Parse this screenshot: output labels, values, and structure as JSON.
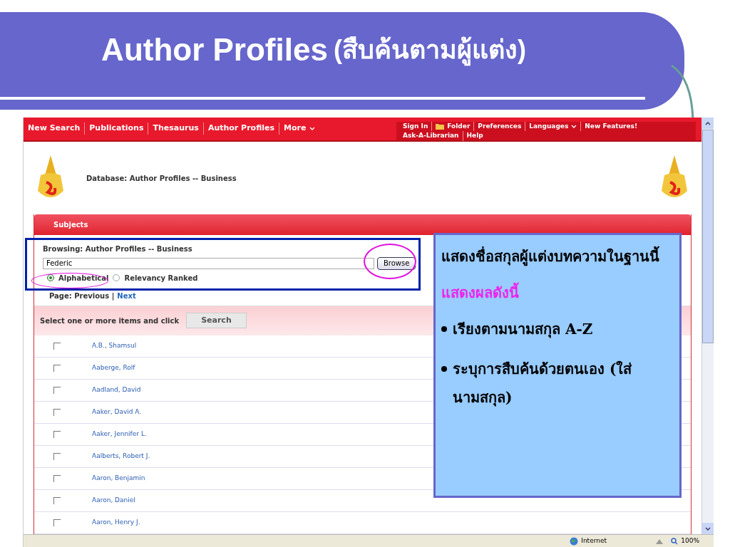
{
  "slide": {
    "title": "Author Profiles",
    "title_thai": "(สืบค้นตามผู้แต่ง)"
  },
  "nav": {
    "left": [
      {
        "label": "New Search",
        "caret": false
      },
      {
        "label": "Publications",
        "caret": false
      },
      {
        "label": "Thesaurus",
        "caret": false
      },
      {
        "label": "Author Profiles",
        "caret": false
      },
      {
        "label": "More",
        "caret": true
      }
    ],
    "right_top": [
      {
        "label": "Sign In",
        "kind": "link"
      },
      {
        "label": "Folder",
        "kind": "folder"
      },
      {
        "label": "Preferences",
        "kind": "link"
      },
      {
        "label": "Languages",
        "kind": "caret"
      },
      {
        "label": "New Features!",
        "kind": "link"
      }
    ],
    "right_bottom": [
      {
        "label": "Ask-A-Librarian"
      },
      {
        "label": "Help"
      }
    ]
  },
  "header": {
    "database": "Database: Author Profiles -- Business"
  },
  "panel": {
    "tab": "Subjects",
    "browsing": "Browsing: Author Profiles -- Business",
    "query": "Federic",
    "browse_button": "Browse",
    "sort": [
      {
        "label": "Alphabetical",
        "selected": true
      },
      {
        "label": "Relevancy Ranked",
        "selected": false
      }
    ],
    "page_label": "Page: Previous |",
    "next": "Next",
    "select_text": "Select one or more items and click",
    "search_button": "Search"
  },
  "authors": [
    {
      "name": "A.B., Shamsul",
      "checked": false
    },
    {
      "name": "Aaberge, Rolf",
      "checked": false
    },
    {
      "name": "Aadland, David",
      "checked": false
    },
    {
      "name": "Aaker, David A.",
      "checked": false
    },
    {
      "name": "Aaker, Jennifer L.",
      "checked": false
    },
    {
      "name": "Aalberts, Robert J.",
      "checked": false
    },
    {
      "name": "Aaron, Benjamin",
      "checked": false
    },
    {
      "name": "Aaron, Daniel",
      "checked": false
    },
    {
      "name": "Aaron, Henry J.",
      "checked": false
    }
  ],
  "callout": [
    {
      "kind": "text",
      "text": "แสดงชื่อสกุลผู้แต่งบทความในฐานนี้"
    },
    {
      "kind": "highlight",
      "text": "แสดงผลดังนี้"
    },
    {
      "kind": "bullet",
      "text": "เรียงตามนามสกุล A-Z"
    },
    {
      "kind": "bullet",
      "text": "ระบุการสืบค้นด้วยตนเอง (ใส่นามสกุล)"
    }
  ],
  "status_bar": {
    "zone": "Internet",
    "zoom": "100%"
  }
}
